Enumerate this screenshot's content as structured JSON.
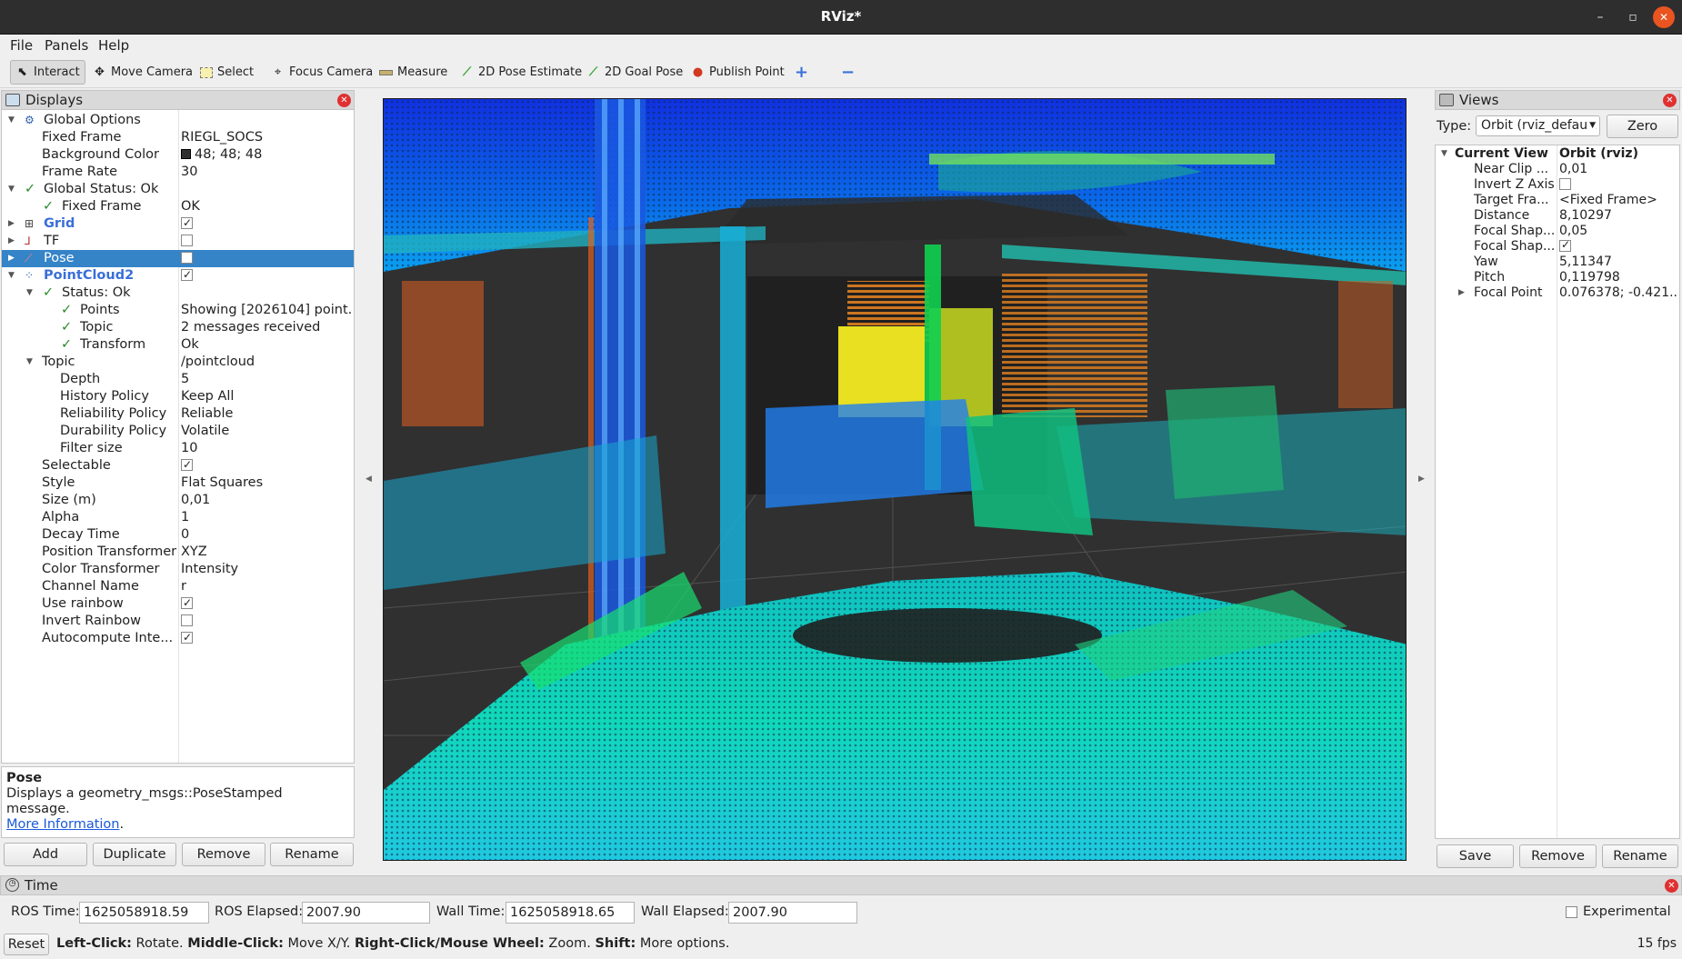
{
  "window": {
    "title": "RViz*",
    "minimize": "–",
    "maximize": "▫",
    "close": "✕"
  },
  "menu": [
    "File",
    "Panels",
    "Help"
  ],
  "toolbar": {
    "interact": "Interact",
    "move_camera": "Move Camera",
    "select": "Select",
    "focus_camera": "Focus Camera",
    "measure": "Measure",
    "pose_estimate": "2D Pose Estimate",
    "goal_pose": "2D Goal Pose",
    "publish_point": "Publish Point",
    "add": "+",
    "remove": "−"
  },
  "displays": {
    "title": "Displays",
    "global_options": "Global Options",
    "fixed_frame_k": "Fixed Frame",
    "fixed_frame_v": "RIEGL_SOCS",
    "bg_color_k": "Background Color",
    "bg_color_v": "48; 48; 48",
    "frame_rate_k": "Frame Rate",
    "frame_rate_v": "30",
    "global_status": "Global Status: Ok",
    "gs_fixed_frame_k": "Fixed Frame",
    "gs_fixed_frame_v": "OK",
    "grid": "Grid",
    "tf": "TF",
    "pose": "Pose",
    "pointcloud2": "PointCloud2",
    "status_ok": "Status: Ok",
    "points_k": "Points",
    "points_v": "Showing [2026104] point...",
    "topic_status_k": "Topic",
    "topic_status_v": "2 messages received",
    "transform_k": "Transform",
    "transform_v": "Ok",
    "topic_k": "Topic",
    "topic_v": "/pointcloud",
    "depth_k": "Depth",
    "depth_v": "5",
    "history_k": "History Policy",
    "history_v": "Keep All",
    "reliability_k": "Reliability Policy",
    "reliability_v": "Reliable",
    "durability_k": "Durability Policy",
    "durability_v": "Volatile",
    "filter_k": "Filter size",
    "filter_v": "10",
    "selectable_k": "Selectable",
    "style_k": "Style",
    "style_v": "Flat Squares",
    "size_k": "Size (m)",
    "size_v": "0,01",
    "alpha_k": "Alpha",
    "alpha_v": "1",
    "decay_k": "Decay Time",
    "decay_v": "0",
    "pos_tf_k": "Position Transformer",
    "pos_tf_v": "XYZ",
    "color_tf_k": "Color Transformer",
    "color_tf_v": "Intensity",
    "channel_k": "Channel Name",
    "channel_v": "r",
    "rainbow_k": "Use rainbow",
    "invert_rainbow_k": "Invert Rainbow",
    "autocompute_k": "Autocompute Inte..."
  },
  "description": {
    "title": "Pose",
    "text": "Displays a geometry_msgs::PoseStamped message.",
    "link": "More Information",
    "link_suffix": "."
  },
  "display_buttons": {
    "add": "Add",
    "duplicate": "Duplicate",
    "remove": "Remove",
    "rename": "Rename"
  },
  "views": {
    "title": "Views",
    "type_label": "Type:",
    "type_value": "Orbit (rviz_default",
    "zero": "Zero",
    "current_view_k": "Current View",
    "current_view_v": "Orbit (rviz)",
    "near_clip_k": "Near Clip ...",
    "near_clip_v": "0,01",
    "invert_z_k": "Invert Z Axis",
    "target_frame_k": "Target Fra...",
    "target_frame_v": "<Fixed Frame>",
    "distance_k": "Distance",
    "distance_v": "8,10297",
    "focal_shape1_k": "Focal Shap...",
    "focal_shape1_v": "0,05",
    "focal_shape2_k": "Focal Shap...",
    "yaw_k": "Yaw",
    "yaw_v": "5,11347",
    "pitch_k": "Pitch",
    "pitch_v": "0,119798",
    "focal_point_k": "Focal Point",
    "focal_point_v": "0.076378; -0.421...",
    "save": "Save",
    "remove": "Remove",
    "rename": "Rename"
  },
  "time": {
    "title": "Time",
    "ros_time_label": "ROS Time:",
    "ros_time": "1625058918.59",
    "ros_elapsed_label": "ROS Elapsed:",
    "ros_elapsed": "2007.90",
    "wall_time_label": "Wall Time:",
    "wall_time": "1625058918.65",
    "wall_elapsed_label": "Wall Elapsed:",
    "wall_elapsed": "2007.90",
    "experimental": "Experimental"
  },
  "statusbar": {
    "reset": "Reset",
    "left_click_b": "Left-Click:",
    "left_click": " Rotate. ",
    "middle_click_b": "Middle-Click:",
    "middle_click": " Move X/Y. ",
    "right_click_b": "Right-Click/Mouse Wheel:",
    "right_click": " Zoom. ",
    "shift_b": "Shift:",
    "shift": " More options.",
    "fps": "15 fps"
  },
  "colors": {
    "background": "#303030",
    "selection": "#3584c8",
    "close": "#e95420"
  }
}
